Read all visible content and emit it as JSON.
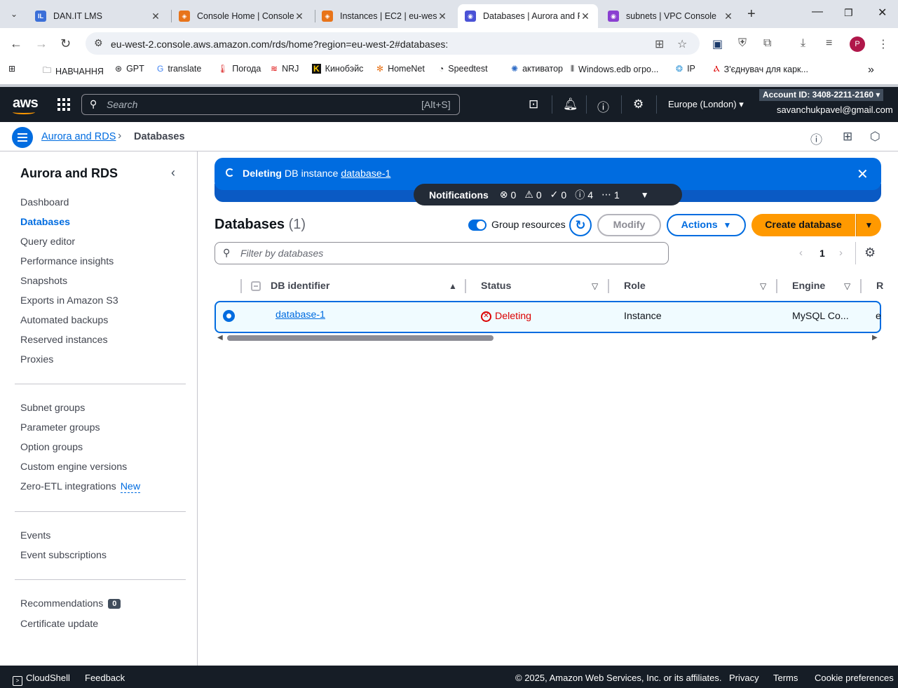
{
  "browser": {
    "tabs": [
      {
        "title": "DAN.IT LMS",
        "icon": "dan-it-icon",
        "color": "#3b6fd8"
      },
      {
        "title": "Console Home | Console",
        "icon": "aws-console-icon",
        "color": "#e8741a"
      },
      {
        "title": "Instances | EC2 | eu-west",
        "icon": "ec2-icon",
        "color": "#e8741a"
      },
      {
        "title": "Databases | Aurora and R",
        "icon": "rds-icon",
        "color": "#4a52d6"
      },
      {
        "title": "subnets | VPC Console",
        "icon": "vpc-icon",
        "color": "#8a3fd1"
      }
    ],
    "url": "eu-west-2.console.aws.amazon.com/rds/home?region=eu-west-2#databases:",
    "profile_initial": "P",
    "bookmarks": [
      "НАВЧАННЯ",
      "GPT",
      "translate",
      "Погода",
      "NRJ",
      "Кинобэйс",
      "HomeNet",
      "Speedtest",
      "активатор",
      "Windows.edb огро...",
      "IP",
      "З'єднувач для карк..."
    ]
  },
  "aws": {
    "search_placeholder": "Search",
    "search_shortcut": "[Alt+S]",
    "region": "Europe (London)",
    "account_id": "Account ID: 3408-2211-2160",
    "email": "savanchukpavel@gmail.com"
  },
  "breadcrumb": {
    "parent": "Aurora and RDS",
    "current": "Databases"
  },
  "sidenav": {
    "title": "Aurora and RDS",
    "group1": [
      "Dashboard",
      "Databases",
      "Query editor",
      "Performance insights",
      "Snapshots",
      "Exports in Amazon S3",
      "Automated backups",
      "Reserved instances",
      "Proxies"
    ],
    "group2": [
      "Subnet groups",
      "Parameter groups",
      "Option groups",
      "Custom engine versions",
      "Zero-ETL integrations"
    ],
    "new_label": "New",
    "group3": [
      "Events",
      "Event subscriptions"
    ],
    "recommendations_label": "Recommendations",
    "recommendations_count": "0",
    "certificate_update": "Certificate update",
    "active_item": "Databases"
  },
  "flash": {
    "bold": "Deleting",
    "text": "DB instance",
    "link": "database-1"
  },
  "notifications": {
    "title": "Notifications",
    "errors": "0",
    "warnings": "0",
    "success": "0",
    "info": "4",
    "in_progress": "1"
  },
  "databases": {
    "title": "Databases",
    "count": "(1)",
    "group_resources": "Group resources",
    "modify": "Modify",
    "actions": "Actions",
    "create": "Create database",
    "filter_placeholder": "Filter by databases",
    "page": "1",
    "columns": [
      "DB identifier",
      "Status",
      "Role",
      "Engine",
      "R"
    ],
    "rows": [
      {
        "identifier": "database-1",
        "status": "Deleting",
        "role": "Instance",
        "engine": "MySQL Co...",
        "region": "e"
      }
    ]
  },
  "footer": {
    "cloudshell": "CloudShell",
    "feedback": "Feedback",
    "copyright": "© 2025, Amazon Web Services, Inc. or its affiliates.",
    "privacy": "Privacy",
    "terms": "Terms",
    "cookies": "Cookie preferences"
  }
}
